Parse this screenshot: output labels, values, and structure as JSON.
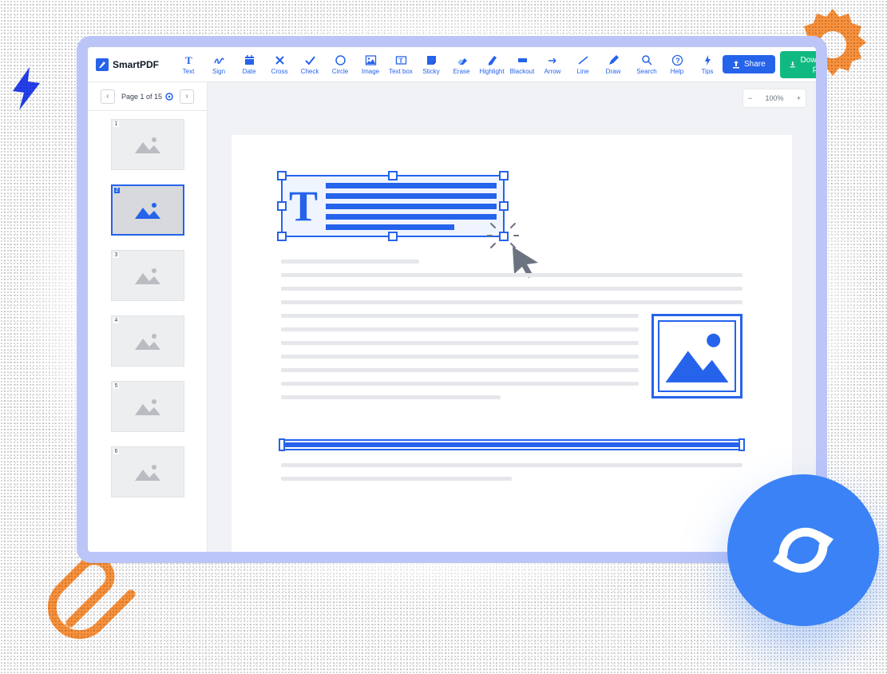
{
  "brand": {
    "name": "SmartPDF"
  },
  "tools": [
    {
      "id": "text",
      "label": "Text"
    },
    {
      "id": "sign",
      "label": "Sign"
    },
    {
      "id": "date",
      "label": "Date"
    },
    {
      "id": "cross",
      "label": "Cross"
    },
    {
      "id": "check",
      "label": "Check"
    },
    {
      "id": "circle",
      "label": "Circle"
    },
    {
      "id": "image",
      "label": "Image"
    },
    {
      "id": "textbox",
      "label": "Text box"
    },
    {
      "id": "sticky",
      "label": "Sticky"
    },
    {
      "id": "erase",
      "label": "Erase"
    },
    {
      "id": "highlight",
      "label": "Highlight"
    },
    {
      "id": "blackout",
      "label": "Blackout"
    },
    {
      "id": "arrow",
      "label": "Arrow"
    },
    {
      "id": "line",
      "label": "Line"
    },
    {
      "id": "draw",
      "label": "Draw"
    }
  ],
  "rightTools": [
    {
      "id": "search",
      "label": "Search"
    },
    {
      "id": "help",
      "label": "Help"
    },
    {
      "id": "tips",
      "label": "Tips"
    }
  ],
  "buttons": {
    "share": "Share",
    "download": "Download pdf"
  },
  "page": {
    "indicator": "Page 1 of 15",
    "current": 1,
    "total": 15
  },
  "zoom": {
    "value": "100%"
  },
  "thumbnails": [
    {
      "num": "1"
    },
    {
      "num": "2",
      "active": true
    },
    {
      "num": "3"
    },
    {
      "num": "4"
    },
    {
      "num": "5"
    },
    {
      "num": "6"
    }
  ],
  "canvas": {
    "textbox_letter": "T"
  },
  "colors": {
    "primary": "#2563eb",
    "success": "#10b981",
    "accent_orange": "#fb923c",
    "frame": "#bcc5f7",
    "page_bg": "#f1f2f6"
  }
}
